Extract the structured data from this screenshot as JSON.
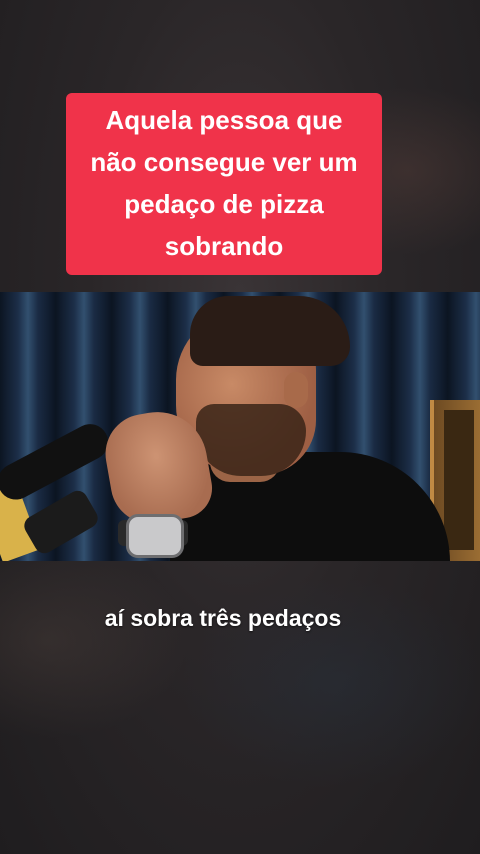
{
  "overlay_caption": {
    "lines": [
      "Aquela pessoa que",
      "não consegue ver um",
      "pedaço de pizza",
      "sobrando"
    ],
    "background_color": "#f0334a",
    "text_color": "#ffffff"
  },
  "subtitle": {
    "text": "aí sobra três pedaços"
  },
  "video": {
    "scene_description_icon": "podcast-host-icon"
  }
}
